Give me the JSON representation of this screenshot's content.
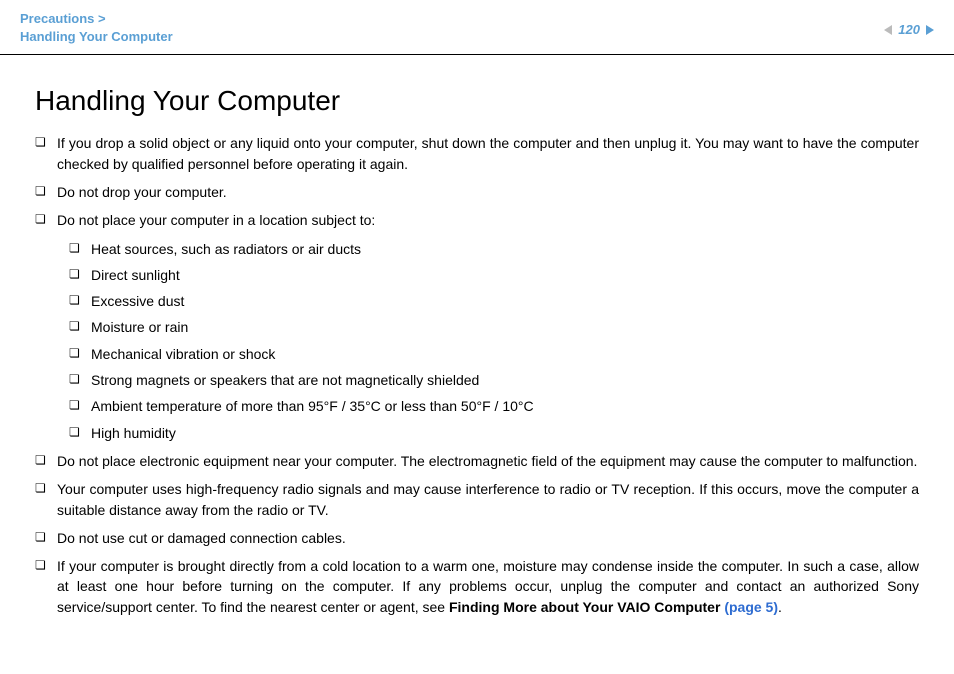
{
  "header": {
    "breadcrumb_section": "Precautions >",
    "breadcrumb_page": "Handling Your Computer",
    "page_number": "120"
  },
  "title": "Handling Your Computer",
  "items": [
    {
      "text": "If you drop a solid object or any liquid onto your computer, shut down the computer and then unplug it. You may want to have the computer checked by qualified personnel before operating it again."
    },
    {
      "text": "Do not drop your computer."
    },
    {
      "text": "Do not place your computer in a location subject to:",
      "sub": [
        "Heat sources, such as radiators or air ducts",
        "Direct sunlight",
        "Excessive dust",
        "Moisture or rain",
        "Mechanical vibration or shock",
        "Strong magnets or speakers that are not magnetically shielded",
        "Ambient temperature of more than 95°F / 35°C or less than 50°F / 10°C",
        "High humidity"
      ]
    },
    {
      "text": "Do not place electronic equipment near your computer. The electromagnetic field of the equipment may cause the computer to malfunction."
    },
    {
      "text": "Your computer uses high-frequency radio signals and may cause interference to radio or TV reception. If this occurs, move the computer a suitable distance away from the radio or TV."
    },
    {
      "text": "Do not use cut or damaged connection cables."
    },
    {
      "text_parts": [
        {
          "t": "If your computer is brought directly from a cold location to a warm one, moisture may condense inside the computer. In such a case, allow at least one hour before turning on the computer. If any problems occur, unplug the computer and contact an authorized Sony service/support center. To find the nearest center or agent, see "
        },
        {
          "t": "Finding More about Your VAIO Computer ",
          "cls": "bold"
        },
        {
          "t": "(page 5)",
          "cls": "link"
        },
        {
          "t": "."
        }
      ]
    }
  ]
}
